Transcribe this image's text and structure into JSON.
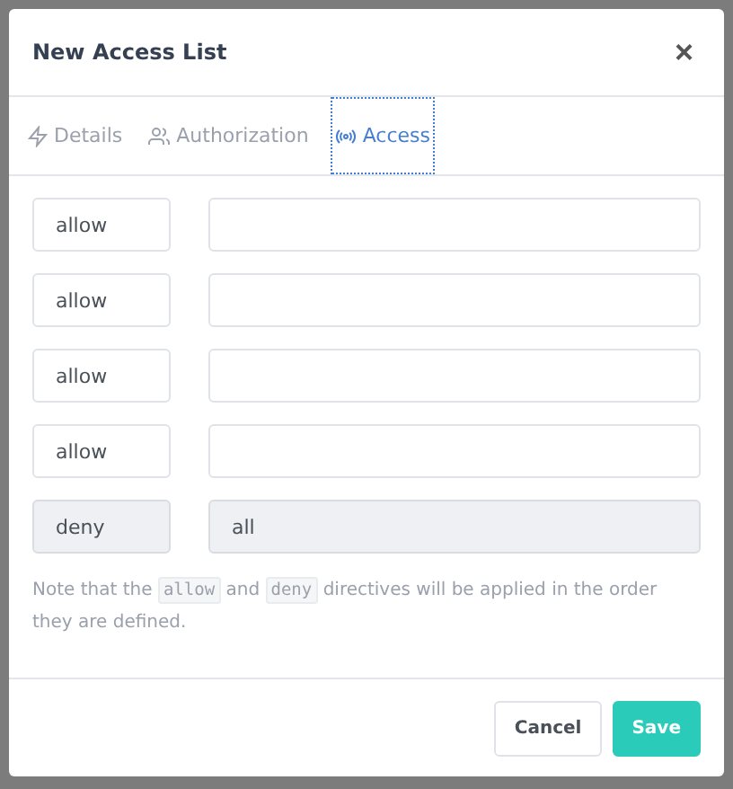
{
  "dialog": {
    "title": "New Access List",
    "close": "×"
  },
  "tabs": [
    {
      "label": "Details",
      "selected": false
    },
    {
      "label": "Authorization",
      "selected": false
    },
    {
      "label": "Access",
      "selected": true
    }
  ],
  "rules": [
    {
      "action": "allow",
      "disabled": false
    },
    {
      "action": "allow",
      "disabled": false
    },
    {
      "action": "allow",
      "disabled": false
    },
    {
      "action": "allow",
      "disabled": false
    },
    {
      "action": "deny",
      "address": "all",
      "disabled": true
    }
  ],
  "note": [
    {
      "kind": "text",
      "text": "Note that the"
    },
    {
      "kind": "code",
      "text": "allow"
    },
    {
      "kind": "text",
      "text": "and"
    },
    {
      "kind": "code",
      "text": "deny"
    },
    {
      "kind": "text",
      "text": "directives will be applied in the order they are defined."
    }
  ],
  "buttons": [
    {
      "label": "Cancel",
      "kind": "secondary"
    },
    {
      "label": "Save",
      "kind": "primary"
    }
  ]
}
